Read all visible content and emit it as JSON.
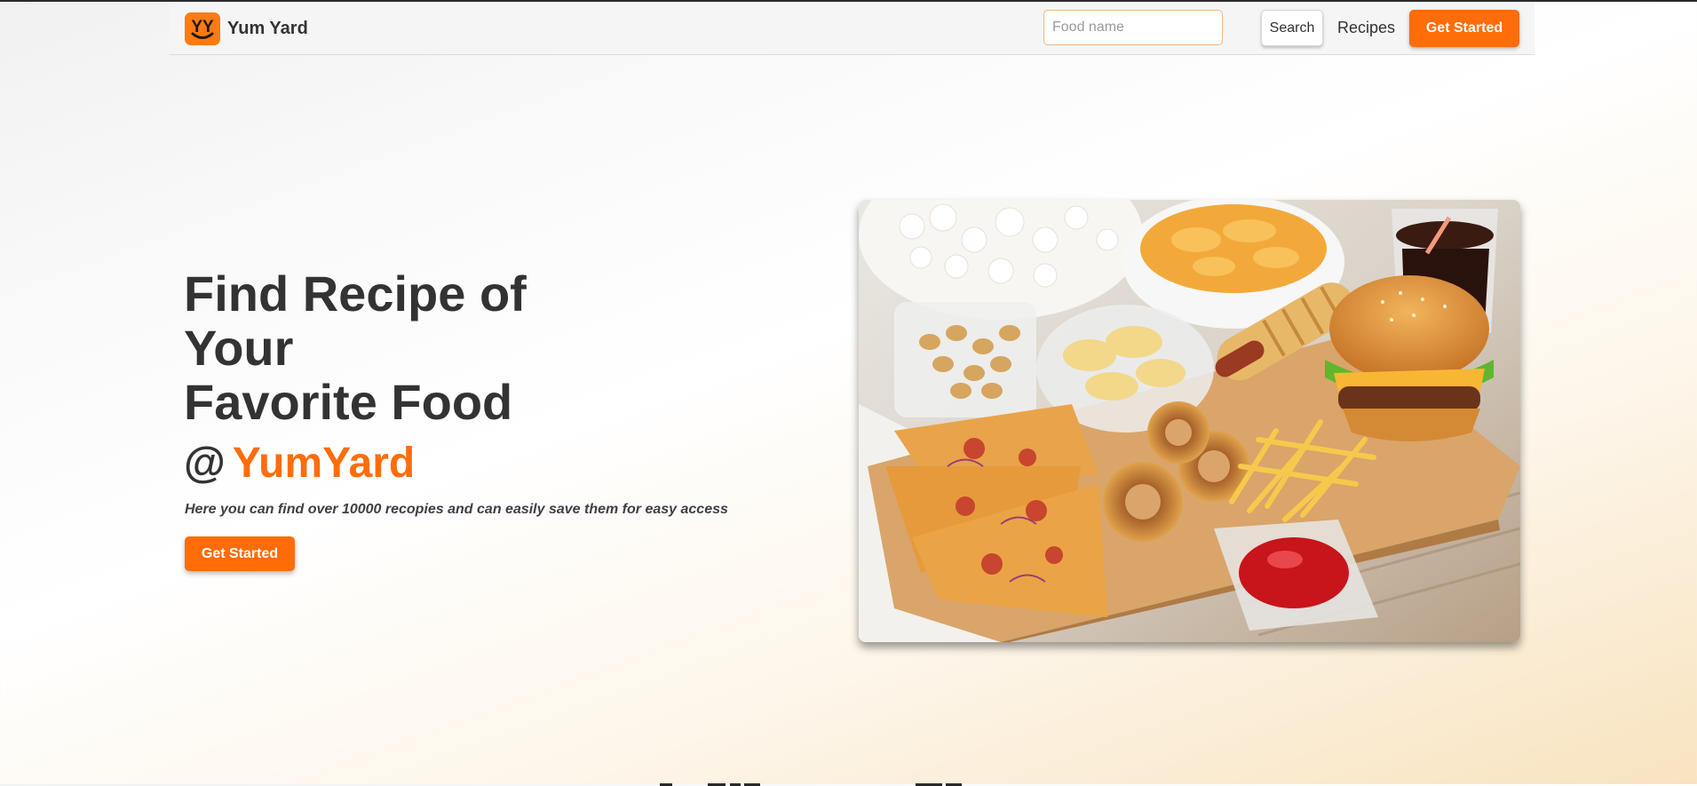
{
  "navbar": {
    "brand_name": "Yum Yard",
    "logo_icon": "smiley-yy-logo",
    "search_placeholder": "Food name",
    "search_label": "Search",
    "recipes_link": "Recipes",
    "cta_label": "Get Started"
  },
  "hero": {
    "title_lines": [
      "Find Recipe of",
      "Your",
      "Favorite Food"
    ],
    "at_symbol": "@",
    "brand": "YumYard",
    "description": "Here you can find over 10000 recopies and can easily save them for easy access",
    "cta_label": "Get Started",
    "image_icon": "fast-food-photo"
  },
  "colors": {
    "accent": "#ff6c08",
    "text": "#333333",
    "background_warm": "#f8e3bf"
  }
}
